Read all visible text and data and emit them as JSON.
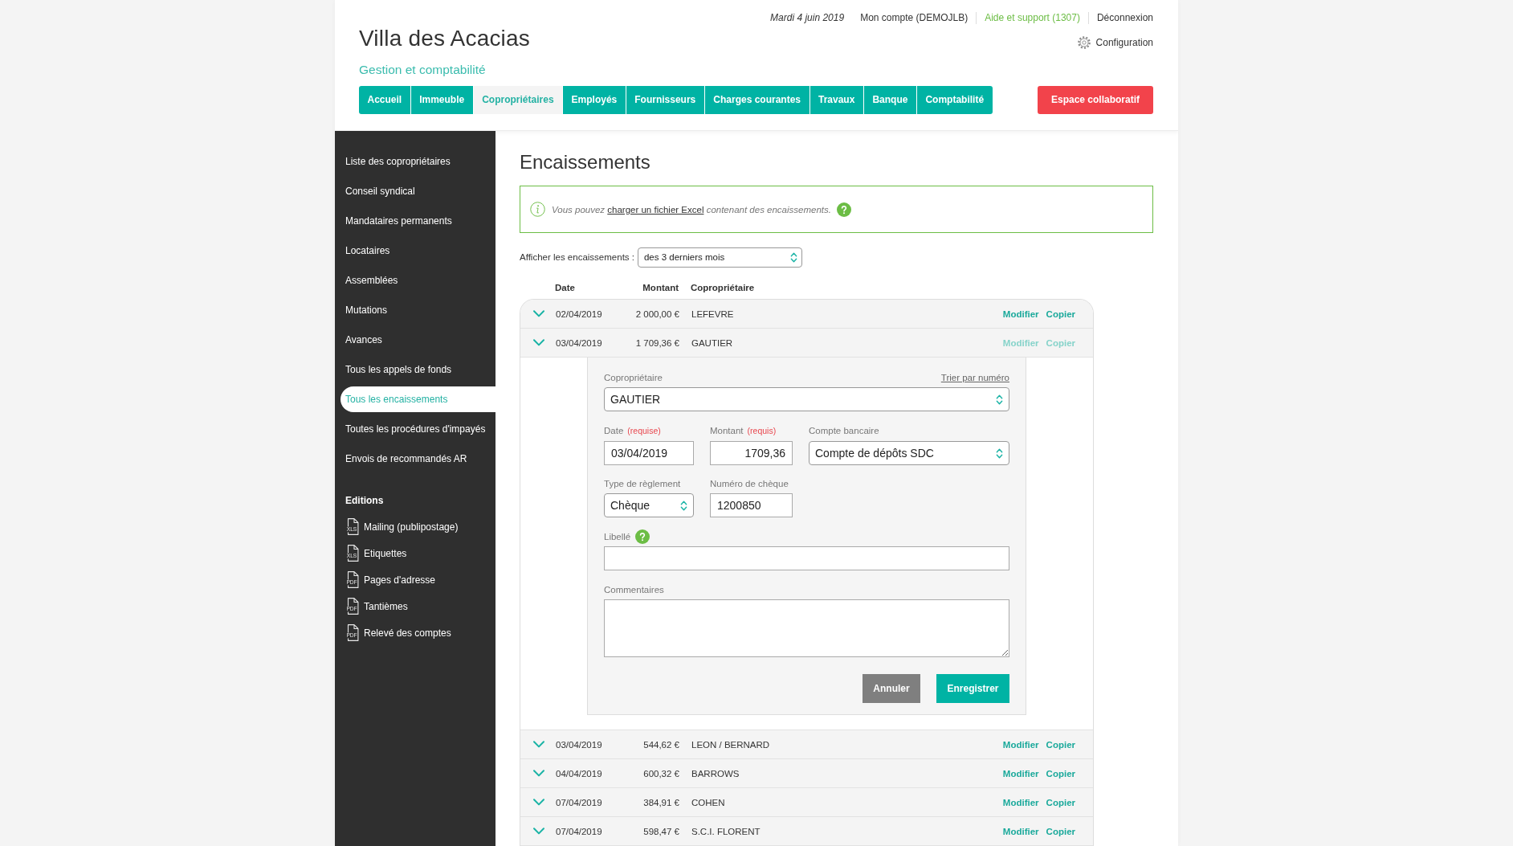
{
  "header": {
    "title": "Villa des Acacias",
    "subtitle": "Gestion et comptabilité",
    "date": "Mardi 4 juin 2019",
    "account_link": "Mon compte (DEMOJLB)",
    "support_link": "Aide et support (1307)",
    "logout_link": "Déconnexion",
    "settings_link": "Configuration"
  },
  "nav_tabs": [
    {
      "label": "Accueil",
      "selected": false
    },
    {
      "label": "Immeuble",
      "selected": false
    },
    {
      "label": "Copropriétaires",
      "selected": true
    },
    {
      "label": "Employés",
      "selected": false
    },
    {
      "label": "Fournisseurs",
      "selected": false
    },
    {
      "label": "Charges courantes",
      "selected": false
    },
    {
      "label": "Travaux",
      "selected": false
    },
    {
      "label": "Banque",
      "selected": false
    },
    {
      "label": "Comptabilité",
      "selected": false
    }
  ],
  "collab_button": "Espace collaboratif",
  "sidebar": {
    "items": [
      {
        "label": "Liste des copropriétaires",
        "selected": false
      },
      {
        "label": "Conseil syndical",
        "selected": false
      },
      {
        "label": "Mandataires permanents",
        "selected": false
      },
      {
        "label": "Locataires",
        "selected": false
      },
      {
        "label": "Assemblées",
        "selected": false
      },
      {
        "label": "Mutations",
        "selected": false
      },
      {
        "label": "Avances",
        "selected": false
      },
      {
        "label": "Tous les appels de fonds",
        "selected": false
      },
      {
        "label": "Tous les encaissements",
        "selected": true
      },
      {
        "label": "Toutes les procédures d'impayés",
        "selected": false
      },
      {
        "label": "Envois de recommandés AR",
        "selected": false
      }
    ],
    "editions_heading": "Editions",
    "editions": [
      {
        "label": "Mailing (publipostage)",
        "file_type": "XLS"
      },
      {
        "label": "Etiquettes",
        "file_type": "XLS"
      },
      {
        "label": "Pages d'adresse",
        "file_type": "PDF"
      },
      {
        "label": "Tantièmes",
        "file_type": "PDF"
      },
      {
        "label": "Relevé des comptes",
        "file_type": "PDF"
      }
    ]
  },
  "main": {
    "title": "Encaissements",
    "info": {
      "text_before": "Vous pouvez ",
      "link": "charger un fichier Excel",
      "text_after": " contenant des encaissements."
    },
    "filter": {
      "label": "Afficher les encaissements :",
      "value": "des 3 derniers mois"
    },
    "table": {
      "columns": [
        "Date",
        "Montant",
        "Copropriétaire"
      ],
      "rows": [
        {
          "date": "02/04/2019",
          "amount": "2 000,00 €",
          "owner": "LEFEVRE",
          "edit_link": "Modifier",
          "copy_link": "Copier",
          "expanded": false
        },
        {
          "date": "03/04/2019",
          "amount": "1 709,36 €",
          "owner": "GAUTIER",
          "edit_link": "Modifier",
          "copy_link": "Copier",
          "expanded": true
        },
        {
          "date": "03/04/2019",
          "amount": "544,62 €",
          "owner": "LEON / BERNARD",
          "edit_link": "Modifier",
          "copy_link": "Copier",
          "expanded": false
        },
        {
          "date": "04/04/2019",
          "amount": "600,32 €",
          "owner": "BARROWS",
          "edit_link": "Modifier",
          "copy_link": "Copier",
          "expanded": false
        },
        {
          "date": "07/04/2019",
          "amount": "384,91 €",
          "owner": "COHEN",
          "edit_link": "Modifier",
          "copy_link": "Copier",
          "expanded": false
        },
        {
          "date": "07/04/2019",
          "amount": "598,47 €",
          "owner": "S.C.I. FLORENT",
          "edit_link": "Modifier",
          "copy_link": "Copier",
          "expanded": false
        }
      ],
      "edit_form": {
        "owner": {
          "label": "Copropriétaire",
          "sort_link": "Trier par numéro",
          "value": "GAUTIER"
        },
        "date": {
          "label": "Date",
          "required_note": "(requise)",
          "value": "03/04/2019"
        },
        "amount": {
          "label": "Montant",
          "required_note": "(requis)",
          "value": "1709,36"
        },
        "bank_account": {
          "label": "Compte bancaire",
          "value": "Compte de dépôts SDC"
        },
        "payment_type": {
          "label": "Type de règlement",
          "value": "Chèque"
        },
        "cheque_number": {
          "label": "Numéro de chèque",
          "value": "1200850"
        },
        "description": {
          "label": "Libellé"
        },
        "comments": {
          "label": "Commentaires"
        },
        "cancel_button": "Annuler",
        "save_button": "Enregistrer"
      }
    }
  }
}
